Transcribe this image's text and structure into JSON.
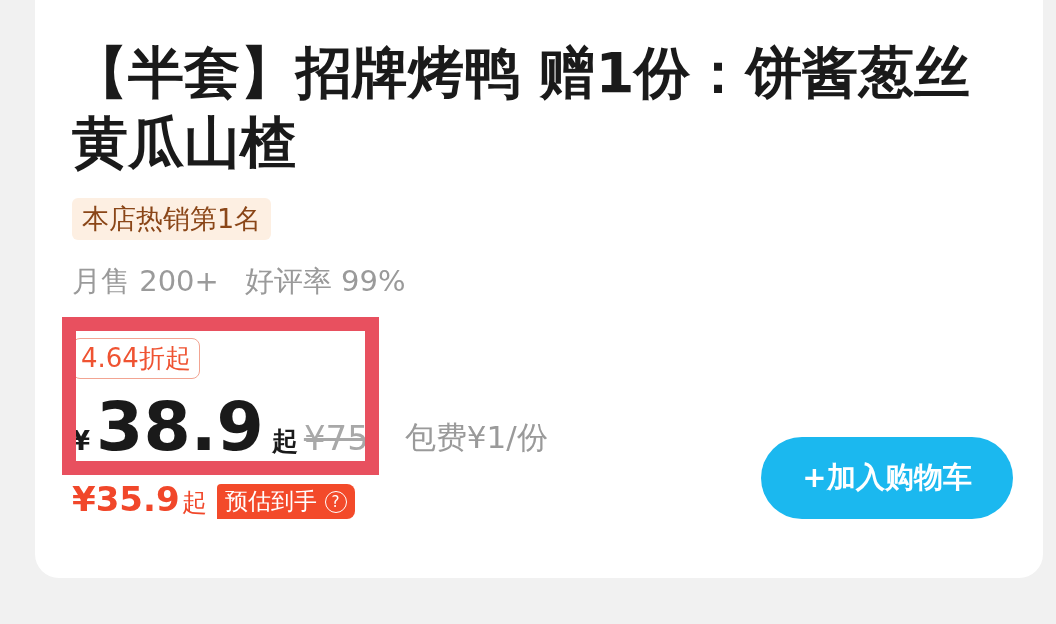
{
  "title": "【半套】招牌烤鸭 赠1份：饼酱葱丝黄瓜山楂",
  "rank_badge": "本店热销第1名",
  "monthly_sales": "月售 200+",
  "rating": "好评率 99%",
  "discount_tag": "4.64折起",
  "price": {
    "currency": "¥",
    "amount": "38.9",
    "suffix": "起",
    "original": "¥75"
  },
  "packing_fee": "包费¥1/份",
  "estimated": {
    "price": "¥35.9",
    "suffix": "起",
    "label": "预估到手",
    "help": "?"
  },
  "add_to_cart": "+加入购物车"
}
